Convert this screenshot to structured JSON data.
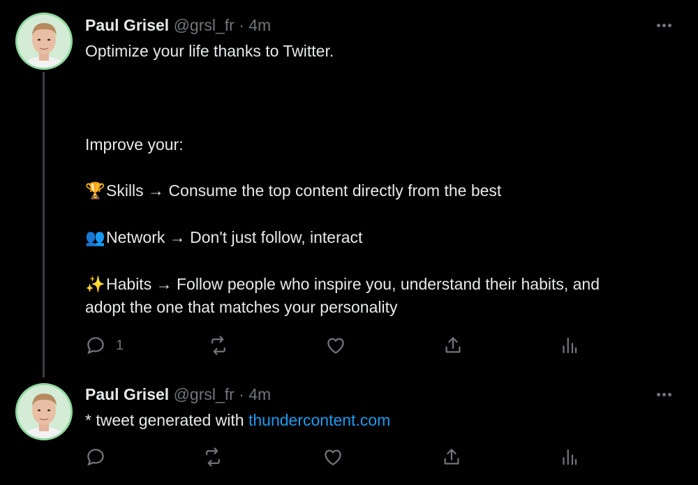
{
  "colors": {
    "background": "#000000",
    "text": "#e7e9ea",
    "secondary": "#71767b",
    "link": "#1d9bf0",
    "avatar_ring": "#8fd9a0",
    "thread_line": "#3a3d41"
  },
  "tweets": [
    {
      "author_name": "Paul Grisel",
      "handle": "@grsl_fr",
      "separator": "·",
      "time": "4m",
      "lines": {
        "intro": "Optimize your life thanks to Twitter.",
        "improve": "Improve your:",
        "skills_emoji": "🏆",
        "skills": "Skills → Consume the top content directly from the best",
        "network_emoji": "👥",
        "network": "Network → Don't just follow, interact",
        "habits_emoji": "✨",
        "habits_1": "Habits → Follow people who inspire you, understand their habits, and",
        "habits_2": "adopt the one that matches your personality"
      },
      "reply_count": "1"
    },
    {
      "author_name": "Paul Grisel",
      "handle": "@grsl_fr",
      "separator": "·",
      "time": "4m",
      "text_prefix": "* tweet generated with ",
      "link_text": "thundercontent.com"
    }
  ],
  "icons": [
    "reply-icon",
    "retweet-icon",
    "like-icon",
    "share-icon",
    "analytics-icon",
    "more-icon"
  ]
}
